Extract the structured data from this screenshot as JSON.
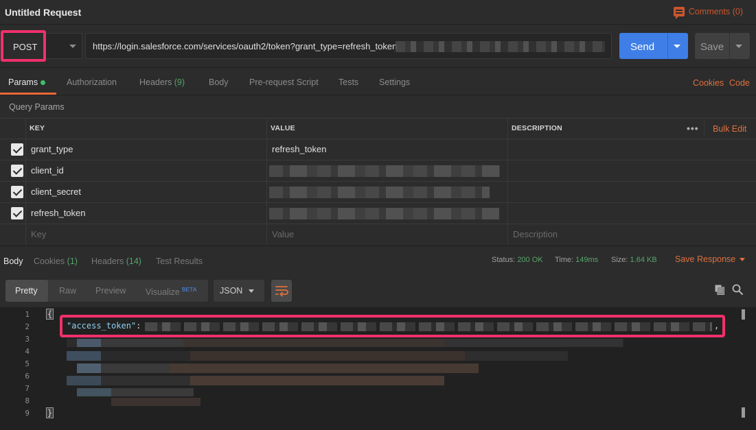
{
  "window": {
    "title": "Untitled Request",
    "comments_label": "Comments (0)"
  },
  "request": {
    "method": "POST",
    "url": "https://login.salesforce.com/services/oauth2/token?grant_type=refresh_token",
    "send_label": "Send",
    "save_label": "Save"
  },
  "request_tabs": {
    "params": "Params",
    "authorization": "Authorization",
    "headers": "Headers",
    "headers_count": "(9)",
    "body": "Body",
    "prerequest": "Pre-request Script",
    "tests": "Tests",
    "settings": "Settings",
    "cookies_link": "Cookies",
    "code_link": "Code"
  },
  "query_params": {
    "title": "Query Params",
    "columns": {
      "key": "KEY",
      "value": "VALUE",
      "description": "DESCRIPTION"
    },
    "bulk_edit": "Bulk Edit",
    "rows": [
      {
        "key": "grant_type",
        "value": "refresh_token",
        "checked": true
      },
      {
        "key": "client_id",
        "value": "",
        "checked": true
      },
      {
        "key": "client_secret",
        "value": "",
        "checked": true
      },
      {
        "key": "refresh_token",
        "value": "",
        "checked": true
      }
    ],
    "placeholders": {
      "key": "Key",
      "value": "Value",
      "description": "Description"
    }
  },
  "response": {
    "tabs": {
      "body": "Body",
      "cookies": "Cookies",
      "cookies_count": "(1)",
      "headers": "Headers",
      "headers_count": "(14)",
      "test_results": "Test Results"
    },
    "status_label": "Status:",
    "status_value": "200 OK",
    "time_label": "Time:",
    "time_value": "149ms",
    "size_label": "Size:",
    "size_value": "1.64 KB",
    "save_response": "Save Response",
    "view_modes": [
      "Pretty",
      "Raw",
      "Preview",
      "Visualize"
    ],
    "beta_badge": "BETA",
    "format": "JSON",
    "line_numbers": [
      "1",
      "2",
      "3",
      "4",
      "5",
      "6",
      "7",
      "8",
      "9"
    ],
    "open_brace": "{",
    "close_brace": "}",
    "access_token_key": "\"access_token\"",
    "colon": ":",
    "comma": ","
  },
  "colors": {
    "accent_orange": "#e0703e",
    "send_blue": "#3e7ee6",
    "highlight_pink": "#f0306c",
    "success_green": "#57a66a"
  }
}
